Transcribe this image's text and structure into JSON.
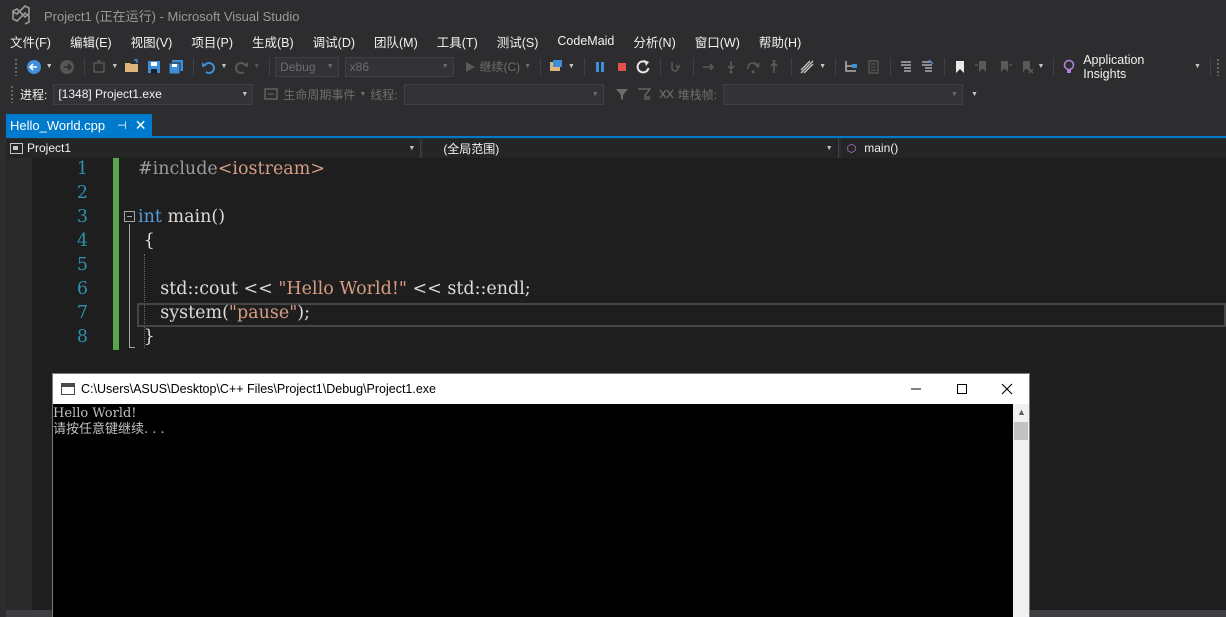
{
  "window": {
    "title": "Project1 (正在运行) - Microsoft Visual Studio"
  },
  "menu": [
    "文件(F)",
    "编辑(E)",
    "视图(V)",
    "项目(P)",
    "生成(B)",
    "调试(D)",
    "团队(M)",
    "工具(T)",
    "测试(S)",
    "CodeMaid",
    "分析(N)",
    "窗口(W)",
    "帮助(H)"
  ],
  "toolbar": {
    "config": "Debug",
    "platform": "x86",
    "continue_label": "继续(C)",
    "app_insights": "Application Insights"
  },
  "debug_toolbar": {
    "process_label": "进程:",
    "process_value": "[1348] Project1.exe",
    "lifecycle_label": "生命周期事件",
    "thread_label": "线程:",
    "stackframe_label": "堆栈帧:"
  },
  "tab": {
    "name": "Hello_World.cpp",
    "pin": "⊣",
    "close": "✕"
  },
  "navbar": {
    "project": "Project1",
    "scope": "(全局范围)",
    "member": "main()"
  },
  "editor": {
    "line_numbers": [
      "1",
      "2",
      "3",
      "4",
      "5",
      "6",
      "7",
      "8"
    ]
  },
  "console": {
    "title": "C:\\Users\\ASUS\\Desktop\\C++ Files\\Project1\\Debug\\Project1.exe",
    "lines": [
      "Hello World!",
      "请按任意键继续. . ."
    ]
  },
  "colors": {
    "accent": "#007acc",
    "background": "#2d2d30",
    "editor_bg": "#1e1e1e",
    "keyword": "#569cd6",
    "string": "#d69d85",
    "line_number": "#2b91af",
    "change_bar": "#57a64a"
  }
}
